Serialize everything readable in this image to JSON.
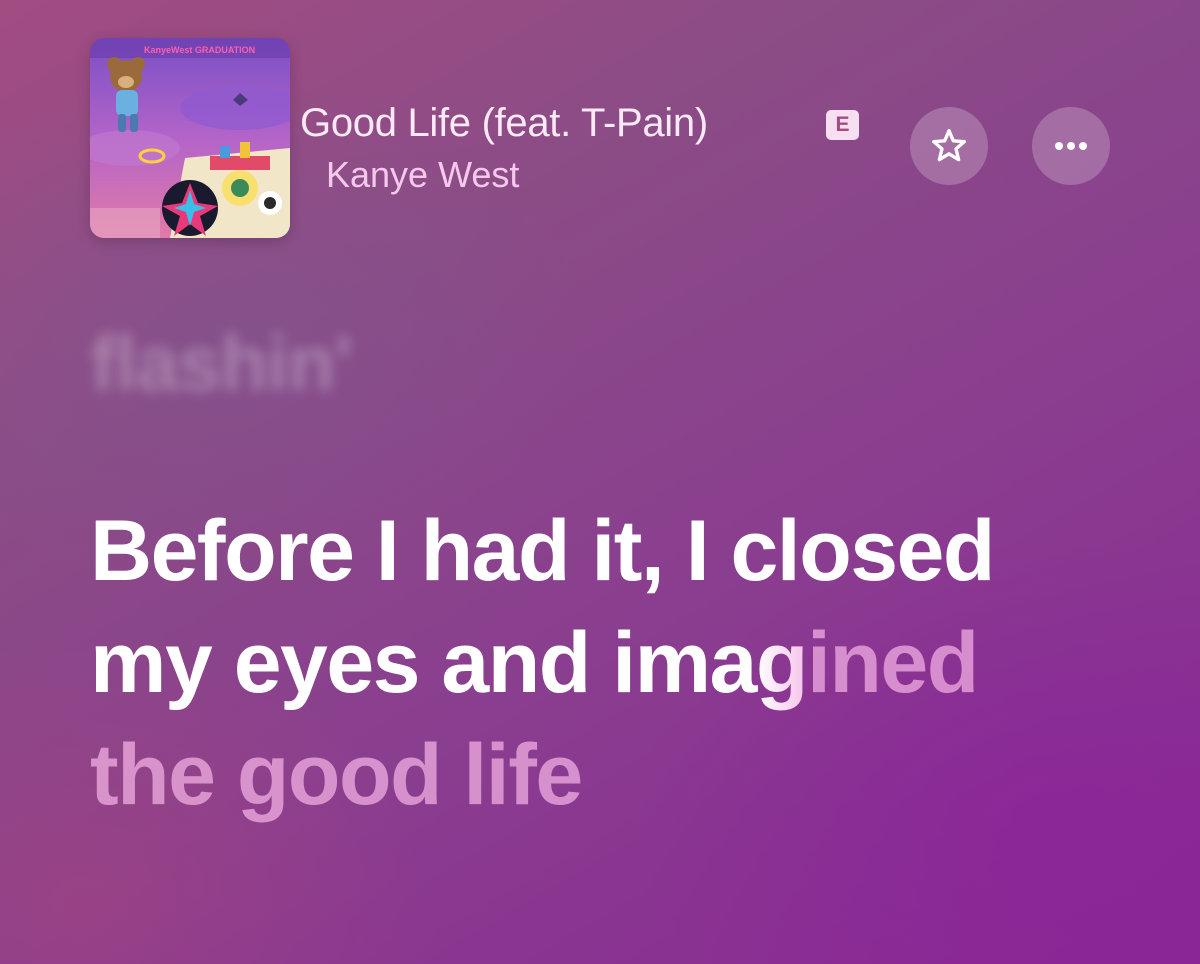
{
  "now_playing": {
    "title": "Good Life (feat. T-Pain)",
    "explicit_badge": "E",
    "artist": "Kanye West",
    "album_art": {
      "header_text": "KanyeWest GRADUATION"
    }
  },
  "actions": {
    "favorite_icon": "star-icon",
    "more_icon": "ellipsis-icon"
  },
  "lyrics": {
    "previous_line": "flashin'",
    "current_line": {
      "sung": "Before I had it, I closed my eyes and ima",
      "transition": "g",
      "unsung": "ined the good life"
    }
  },
  "colors": {
    "background_start": "#a24c82",
    "background_end": "#8a2794",
    "title": "#fce9f6",
    "artist": "#f6c9ec",
    "lyric_sung": "#ffffff",
    "lyric_unsung": "#f5b9e6"
  }
}
